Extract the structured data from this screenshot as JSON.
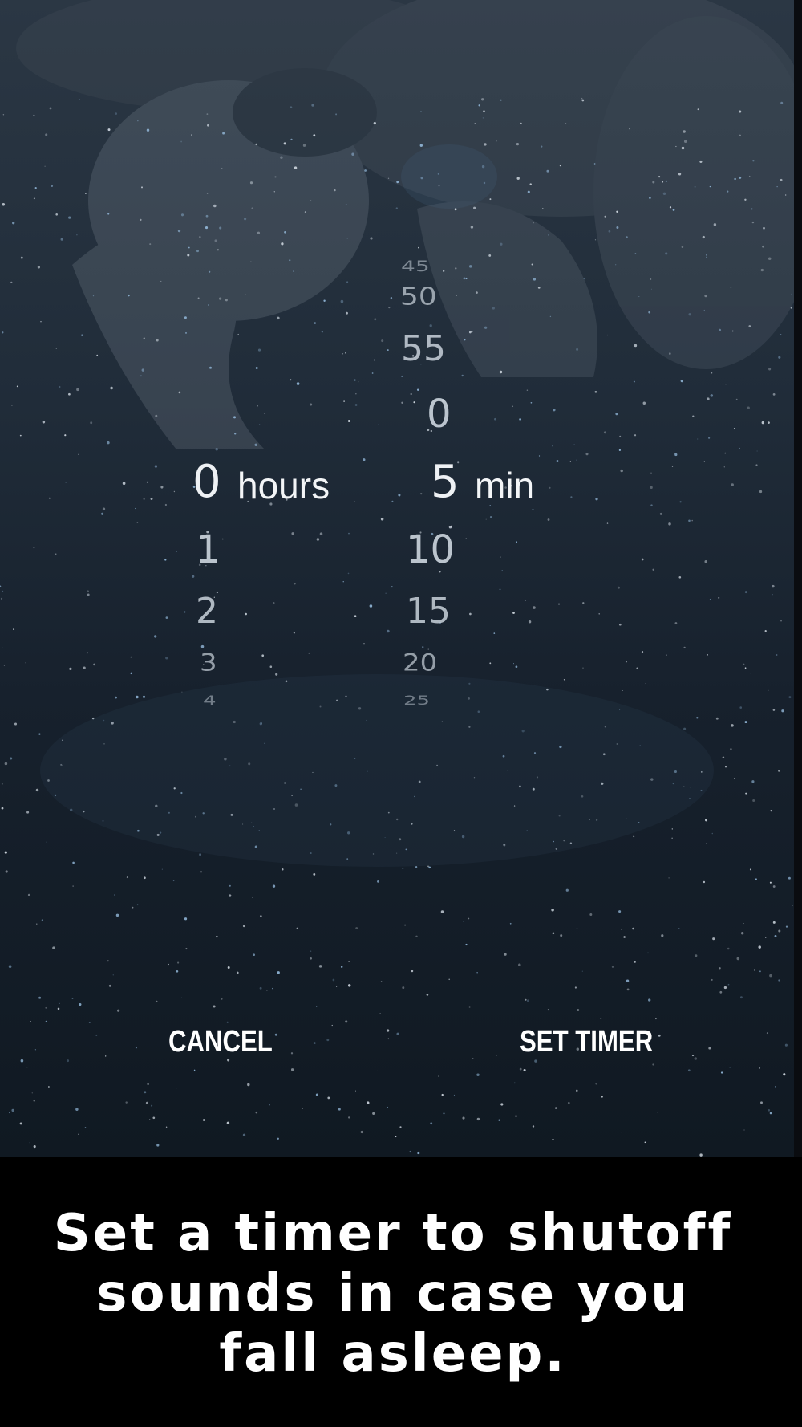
{
  "timer_picker": {
    "hours": {
      "values_above": [],
      "selected_value": "0",
      "unit_label": "hours",
      "values_below": [
        "1",
        "2",
        "3",
        "4"
      ]
    },
    "minutes": {
      "values_above": [
        "45",
        "50",
        "55",
        "0"
      ],
      "selected_value": "5",
      "unit_label": "min",
      "values_below": [
        "10",
        "15",
        "20",
        "25"
      ]
    }
  },
  "actions": {
    "cancel_label": "CANCEL",
    "set_timer_label": "SET TIMER"
  },
  "caption": {
    "lines": [
      "Set a timer to shutoff",
      "sounds in case you",
      "fall asleep."
    ]
  },
  "colors": {
    "background_sky": "#1b2632",
    "caption_band": "#000000",
    "text_primary": "#ffffff",
    "picker_text": "#c9d2db"
  }
}
